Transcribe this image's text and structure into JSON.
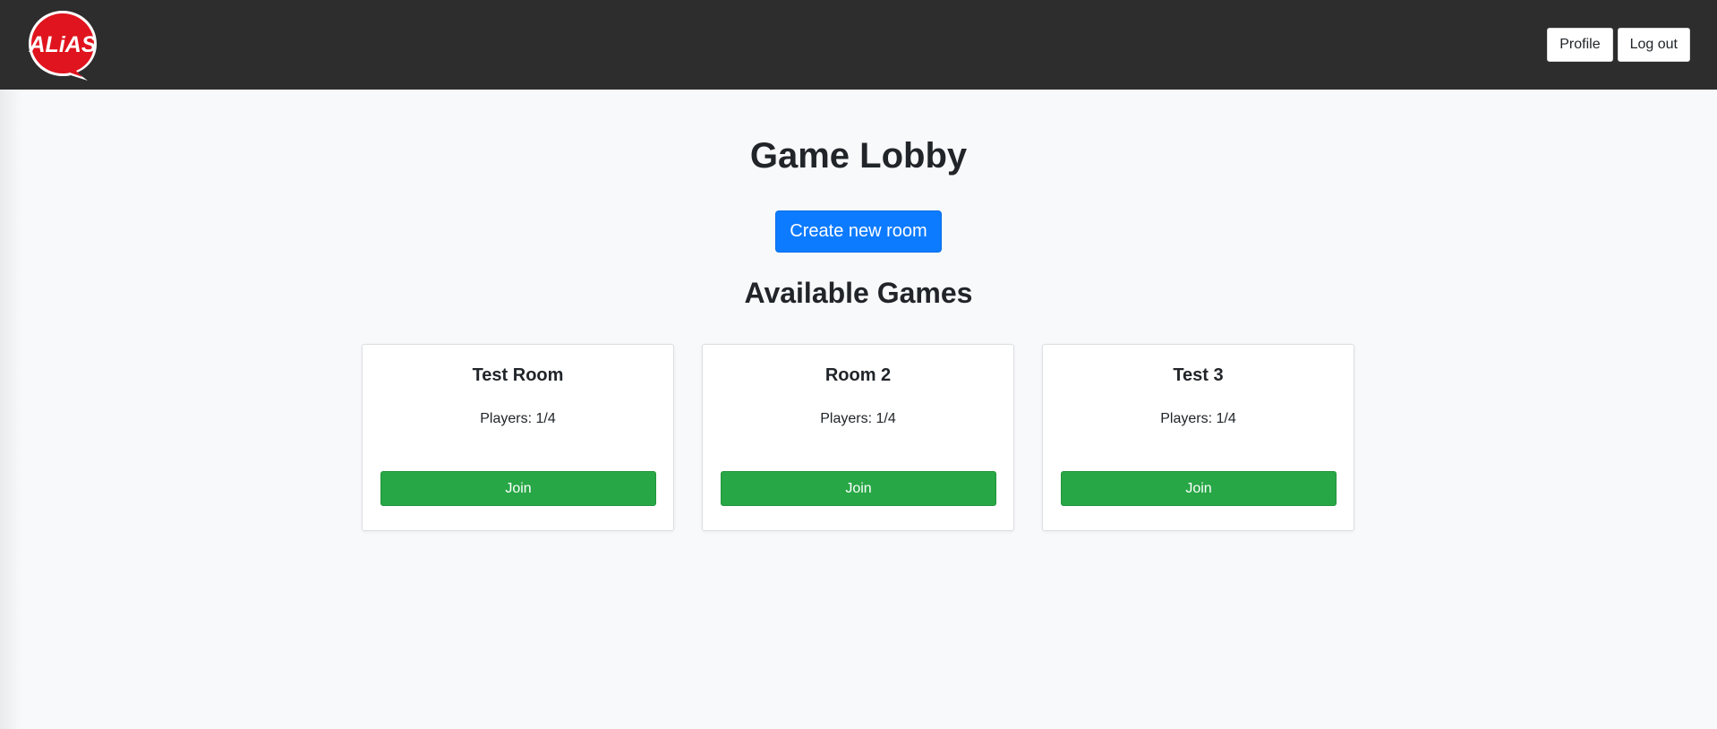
{
  "brand": {
    "logo_text": "ALiAS",
    "logo_color": "#e0141e"
  },
  "nav": {
    "profile_label": "Profile",
    "logout_label": "Log out"
  },
  "lobby": {
    "title": "Game Lobby",
    "create_label": "Create new room",
    "games_title": "Available Games"
  },
  "rooms": [
    {
      "name": "Test Room",
      "players": "Players: 1/4",
      "join_label": "Join"
    },
    {
      "name": "Room 2",
      "players": "Players: 1/4",
      "join_label": "Join"
    },
    {
      "name": "Test 3",
      "players": "Players: 1/4",
      "join_label": "Join"
    }
  ],
  "colors": {
    "navbar": "#2d2d2d",
    "primary": "#0d7bff",
    "success": "#27a745",
    "background": "#f8f9fa"
  }
}
